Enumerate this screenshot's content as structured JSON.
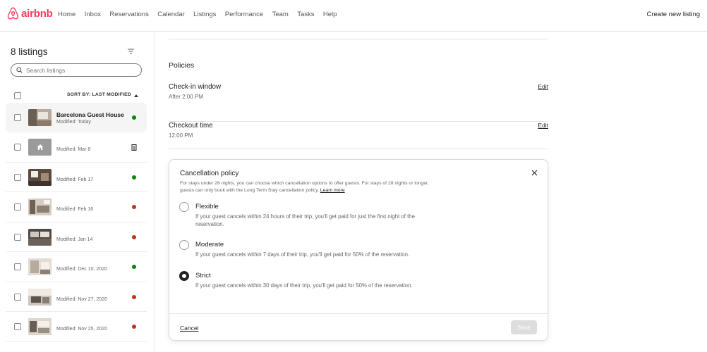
{
  "brand": {
    "name": "airbnb",
    "color": "#ff385c"
  },
  "nav": {
    "items": [
      "Home",
      "Inbox",
      "Reservations",
      "Calendar",
      "Listings",
      "Performance",
      "Team",
      "Tasks",
      "Help"
    ],
    "create_label": "Create new listing"
  },
  "sidebar": {
    "title": "8 listings",
    "search_placeholder": "Search listings",
    "sort_label": "SORT BY: LAST MODIFIED",
    "listings": [
      {
        "name": "Barcelona Guest House",
        "modified": "Modified: Today",
        "status": "green",
        "thumb": "photo"
      },
      {
        "name": "",
        "modified": "Modified: Mar 8",
        "status": "draft",
        "thumb": "placeholder"
      },
      {
        "name": "",
        "modified": "Modified: Feb 17",
        "status": "green",
        "thumb": "photo"
      },
      {
        "name": "",
        "modified": "Modified: Feb 16",
        "status": "red",
        "thumb": "photo"
      },
      {
        "name": "",
        "modified": "Modified: Jan 14",
        "status": "red",
        "thumb": "photo"
      },
      {
        "name": "",
        "modified": "Modified: Dec 10, 2020",
        "status": "green",
        "thumb": "photo"
      },
      {
        "name": "",
        "modified": "Modified: Nov 27, 2020",
        "status": "red",
        "thumb": "photo"
      },
      {
        "name": "",
        "modified": "Modified: Nov 25, 2020",
        "status": "red",
        "thumb": "photo"
      }
    ]
  },
  "main": {
    "section_title": "Policies",
    "checkin": {
      "label": "Check-in window",
      "value": "After 2:00 PM",
      "edit": "Edit"
    },
    "checkout": {
      "label": "Checkout time",
      "value": "12:00 PM",
      "edit": "Edit"
    }
  },
  "modal": {
    "title": "Cancellation policy",
    "description": "For stays under 28 nights, you can choose which cancellation options to offer guests. For stays of 28 nights or longer, guests can only book with the Long Term Stay cancellation policy.",
    "learn_more": "Learn more",
    "options": [
      {
        "label": "Flexible",
        "desc": "If your guest cancels within 24 hours of their trip, you'll get paid for just the first night of the reservation.",
        "checked": false
      },
      {
        "label": "Moderate",
        "desc": "If your guest cancels within 7 days of their trip, you'll get paid for 50% of the reservation.",
        "checked": false
      },
      {
        "label": "Strict",
        "desc": "If your guest cancels within 30 days of their trip, you'll get paid for 50% of the reservation.",
        "checked": true
      }
    ],
    "cancel_label": "Cancel",
    "save_label": "Save"
  }
}
